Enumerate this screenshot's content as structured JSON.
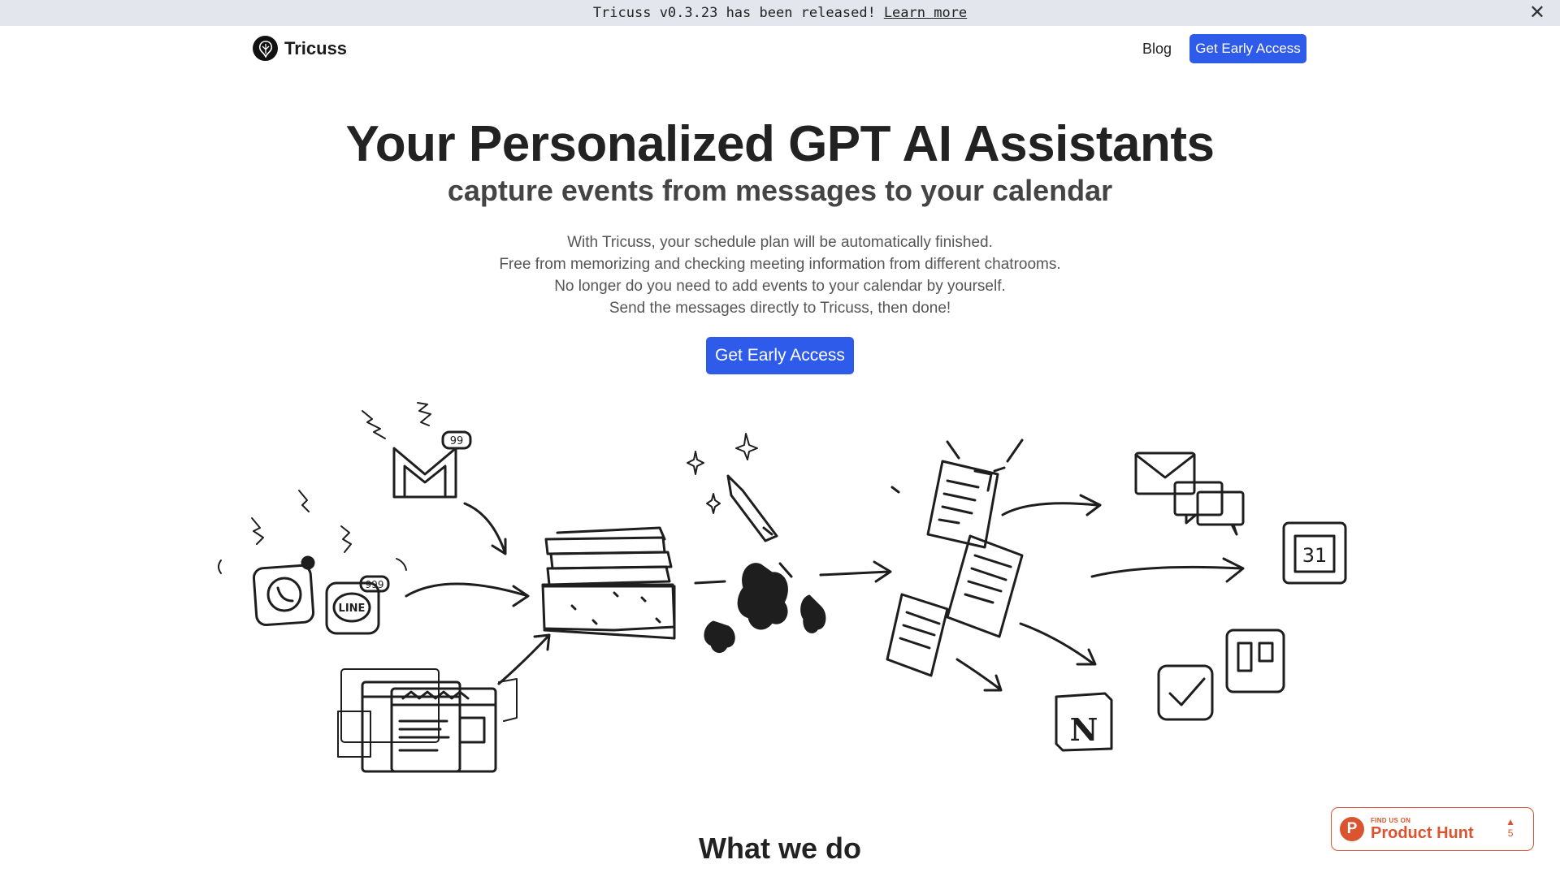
{
  "banner": {
    "message": "Tricuss v0.3.23 has been released!",
    "link": "Learn more",
    "close": "✕"
  },
  "nav": {
    "brand": "Tricuss",
    "blog": "Blog",
    "cta": "Get Early Access"
  },
  "hero": {
    "title": "Your Personalized GPT AI Assistants",
    "subtitle": "capture events from messages to your calendar",
    "description": [
      "With Tricuss, your schedule plan will be automatically finished.",
      "Free from memorizing and checking meeting information from different chatrooms.",
      "No longer do you need to add events to your calendar by yourself.",
      "Send the messages directly to Tricuss, then done!"
    ],
    "cta": "Get Early Access"
  },
  "illustration": {
    "badge_mail": "99",
    "badge_line": "999",
    "line_label": "LINE",
    "calendar_day": "31",
    "notion_letter": "N"
  },
  "section": {
    "title": "What we do"
  },
  "product_hunt": {
    "small": "FIND US ON",
    "big": "Product Hunt",
    "arrow": "▲",
    "votes": "5"
  }
}
